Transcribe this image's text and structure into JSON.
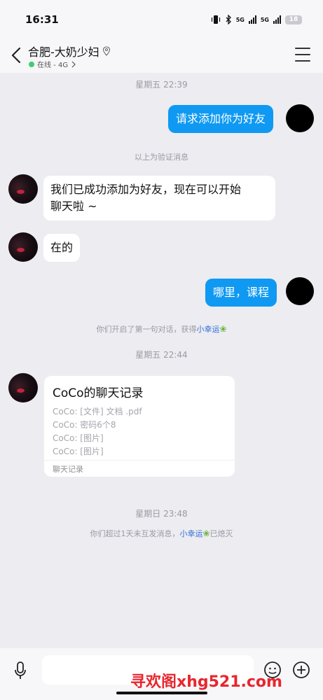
{
  "status_bar": {
    "time": "16:31",
    "signal1_label": "5G",
    "signal2_label": "5G",
    "battery": "18"
  },
  "header": {
    "title": "合肥-大奶少妇",
    "status": "在线 - 4G",
    "online_color": "#3ccf6e"
  },
  "messages": {
    "ts1": "星期五 22:39",
    "out1": "请求添加你为好友",
    "verify_note": "以上为验证消息",
    "in1_line1": "我们已成功添加为好友，现在可以开始",
    "in1_line2": "聊天啦 ~",
    "in2": "在的",
    "out2": "哪里，课程",
    "sys1_prefix": "你们开启了第一句对话，获得",
    "sys1_link": "小幸运",
    "ts2": "星期五 22:44",
    "ts3": "星期日 23:48",
    "sys2_prefix": "你们超过1天未互发消息，",
    "sys2_link": "小幸运",
    "sys2_suffix": "已熄灭"
  },
  "chat_record_card": {
    "title": "CoCo的聊天记录",
    "lines": [
      "CoCo: [文件] 文档 .pdf",
      "CoCo: 密码6个8",
      "CoCo: [图片]",
      "CoCo: [图片]"
    ],
    "footer": "聊天记录"
  },
  "input_bar": {
    "mic_icon": "microphone-icon",
    "emoji_icon": "emoji-icon",
    "plus_icon": "plus-circle-icon"
  },
  "watermark": "寻欢阁xhg521.com",
  "colors": {
    "outgoing_bubble": "#0f99f2",
    "link": "#2f6dd8",
    "background": "#ececf1"
  }
}
